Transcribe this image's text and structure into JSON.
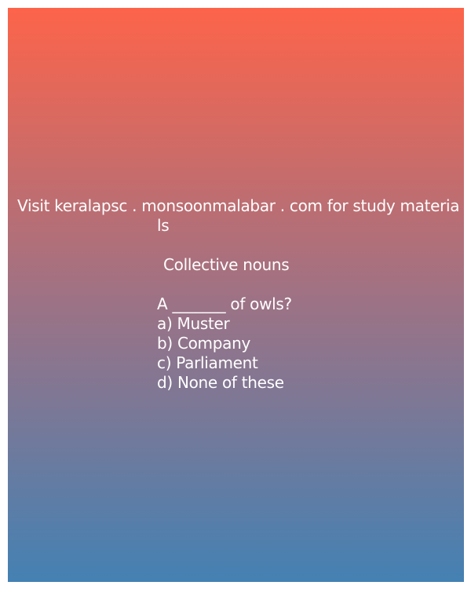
{
  "banner": {
    "line1": "Visit keralapsc . monsoonmalabar . com for study materia",
    "line2": "ls"
  },
  "quiz": {
    "heading": "Collective nouns",
    "question": "A _______ of owls?",
    "options": [
      "a) Muster",
      "b) Company",
      "c) Parliament",
      "d) None of these"
    ]
  },
  "colors": {
    "gradient_top": "#fd644a",
    "gradient_middle": "#9f7284",
    "gradient_bottom": "#4481b3",
    "text": "#ffffff"
  }
}
